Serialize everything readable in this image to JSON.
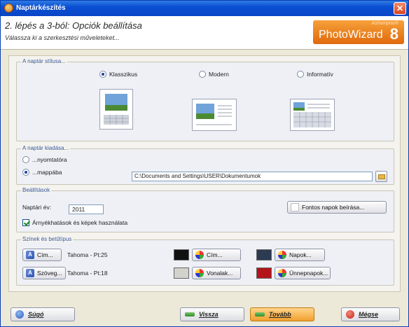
{
  "window": {
    "title": "Naptárkészítés",
    "close_glyph": "✕"
  },
  "header": {
    "step": "2. lépés a 3-ból: Opciók beállítása",
    "subtitle": "Válassza ki a szerkesztési műveleteket...",
    "logo": {
      "brand": "Ashampoo®",
      "name": "PhotoWizard",
      "version": "8"
    }
  },
  "style_group": {
    "legend": "A naptár stílusa...",
    "options": [
      {
        "label": "Klasszikus",
        "selected": true,
        "icon": "classic-calendar-thumb"
      },
      {
        "label": "Modern",
        "selected": false,
        "icon": "modern-calendar-thumb"
      },
      {
        "label": "Informatív",
        "selected": false,
        "icon": "informative-calendar-thumb"
      }
    ]
  },
  "output_group": {
    "legend": "A naptár kiadása...",
    "options": [
      {
        "label": "...nyomtatóra",
        "selected": false
      },
      {
        "label": "...mappába",
        "selected": true
      }
    ],
    "path": "C:\\Documents and Settings\\USER\\Dokumentumok",
    "browse_icon": "folder-icon"
  },
  "settings_group": {
    "legend": "Beállítások",
    "year_label": "Naptári év:",
    "year_value": "2011",
    "important_days_button": "Fontos napok beírása...",
    "shadows_checkbox": {
      "label": "Árnyékhatások és képek használata",
      "checked": true
    }
  },
  "colors_group": {
    "legend": "Színek és betűtípus",
    "fonts": [
      {
        "button": "Cím...",
        "value": "Tahoma - Pt:25"
      },
      {
        "button": "Szöveg...",
        "value": "Tahoma - Pt:18"
      }
    ],
    "colors": [
      {
        "button": "Cím...",
        "color": "#111111"
      },
      {
        "button": "Vonalak...",
        "color": "#d4d2cc"
      },
      {
        "button": "Napok...",
        "color": "#2c3a52"
      },
      {
        "button": "Ünnepnapok...",
        "color": "#b3141a"
      }
    ]
  },
  "footer": {
    "help": "Súgó",
    "back": "Vissza",
    "next": "Tovább",
    "cancel": "Mégse"
  }
}
